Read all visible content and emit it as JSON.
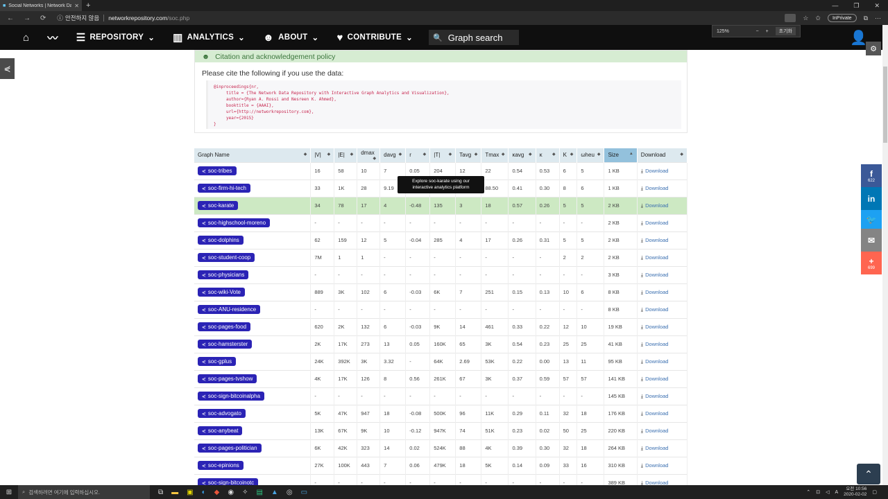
{
  "browser": {
    "tab_title": "Social Networks | Network Data",
    "new_tab": "+",
    "win_min": "—",
    "win_max": "❐",
    "win_close": "✕",
    "nav_back": "←",
    "nav_forward": "→",
    "nav_refresh": "⟳",
    "security_label": "안전하지 않음",
    "url_host": "networkrepository.com",
    "url_path": "/soc.php",
    "inprivate": "InPrivate",
    "zoom_level": "125%",
    "zoom_minus": "−",
    "zoom_plus": "+",
    "zoom_reset": "초기화"
  },
  "sitenav": {
    "items": [
      {
        "label": "",
        "icon": "⌂"
      },
      {
        "label": "",
        "icon": "〰"
      },
      {
        "label": "REPOSITORY",
        "icon": "☰"
      },
      {
        "label": "ANALYTICS",
        "icon": "▥"
      },
      {
        "label": "ABOUT",
        "icon": "☻"
      },
      {
        "label": "CONTRIBUTE",
        "icon": "♥"
      }
    ],
    "search_label": "Graph search",
    "search_icon": "🔍",
    "user_icon": "👤"
  },
  "citation": {
    "heading": "Citation and acknowledgement policy",
    "intro": "Please cite the following if you use the data:",
    "bibtex": "@inproceedings{nr,\n     title = {The Network Data Repository with Interactive Graph Analytics and Visualization},\n     author={Ryan A. Rossi and Nesreen K. Ahmed},\n     booktitle = {AAAI},\n     url={http://networkrepository.com},\n     year={2015}\n}"
  },
  "table": {
    "headers": [
      "Graph Name",
      "|V|",
      "|E|",
      "dmax",
      "davg",
      "r",
      "|T|",
      "Tavg",
      "Tmax",
      "κavg",
      "κ",
      "K",
      "ωheu",
      "Size",
      "Download"
    ],
    "rows": [
      [
        "soc-tribes",
        "16",
        "58",
        "10",
        "7",
        "0.05",
        "204",
        "12",
        "22",
        "0.54",
        "0.53",
        "6",
        "5",
        "1 KB"
      ],
      [
        "soc-firm-hi-tech",
        "33",
        "1K",
        "28",
        "9.19",
        "",
        "",
        "",
        "88.50",
        "0.41",
        "0.30",
        "8",
        "6",
        "1 KB"
      ],
      [
        "soc-karate",
        "34",
        "78",
        "17",
        "4",
        "-0.48",
        "135",
        "3",
        "18",
        "0.57",
        "0.26",
        "5",
        "5",
        "2 KB"
      ],
      [
        "soc-highschool-moreno",
        "-",
        "-",
        "-",
        "-",
        "-",
        "-",
        "-",
        "-",
        "-",
        "-",
        "-",
        "-",
        "2 KB"
      ],
      [
        "soc-dolphins",
        "62",
        "159",
        "12",
        "5",
        "-0.04",
        "285",
        "4",
        "17",
        "0.26",
        "0.31",
        "5",
        "5",
        "2 KB"
      ],
      [
        "soc-student-coop",
        "7M",
        "1",
        "1",
        "-",
        "-",
        "-",
        "-",
        "-",
        "-",
        "-",
        "2",
        "2",
        "2 KB"
      ],
      [
        "soc-physicians",
        "-",
        "-",
        "-",
        "-",
        "-",
        "-",
        "-",
        "-",
        "-",
        "-",
        "-",
        "-",
        "3 KB"
      ],
      [
        "soc-wiki-Vote",
        "889",
        "3K",
        "102",
        "6",
        "-0.03",
        "6K",
        "7",
        "251",
        "0.15",
        "0.13",
        "10",
        "6",
        "8 KB"
      ],
      [
        "soc-ANU-residence",
        "-",
        "-",
        "-",
        "-",
        "-",
        "-",
        "-",
        "-",
        "-",
        "-",
        "-",
        "-",
        "8 KB"
      ],
      [
        "soc-pages-food",
        "620",
        "2K",
        "132",
        "6",
        "-0.03",
        "9K",
        "14",
        "461",
        "0.33",
        "0.22",
        "12",
        "10",
        "19 KB"
      ],
      [
        "soc-hamsterster",
        "2K",
        "17K",
        "273",
        "13",
        "0.05",
        "160K",
        "65",
        "3K",
        "0.54",
        "0.23",
        "25",
        "25",
        "41 KB"
      ],
      [
        "soc-gplus",
        "24K",
        "392K",
        "3K",
        "3.32",
        "-",
        "64K",
        "2.69",
        "53K",
        "0.22",
        "0.00",
        "13",
        "11",
        "95 KB"
      ],
      [
        "soc-pages-tvshow",
        "4K",
        "17K",
        "126",
        "8",
        "0.56",
        "261K",
        "67",
        "3K",
        "0.37",
        "0.59",
        "57",
        "57",
        "141 KB"
      ],
      [
        "soc-sign-bitcoinalpha",
        "-",
        "-",
        "-",
        "-",
        "-",
        "-",
        "-",
        "-",
        "-",
        "-",
        "-",
        "-",
        "145 KB"
      ],
      [
        "soc-advogato",
        "5K",
        "47K",
        "947",
        "18",
        "-0.08",
        "500K",
        "96",
        "11K",
        "0.29",
        "0.11",
        "32",
        "18",
        "176 KB"
      ],
      [
        "soc-anybeat",
        "13K",
        "67K",
        "9K",
        "10",
        "-0.12",
        "947K",
        "74",
        "51K",
        "0.23",
        "0.02",
        "50",
        "25",
        "220 KB"
      ],
      [
        "soc-pages-politician",
        "6K",
        "42K",
        "323",
        "14",
        "0.02",
        "524K",
        "88",
        "4K",
        "0.39",
        "0.30",
        "32",
        "18",
        "264 KB"
      ],
      [
        "soc-epinions",
        "27K",
        "100K",
        "443",
        "7",
        "0.06",
        "479K",
        "18",
        "5K",
        "0.14",
        "0.09",
        "33",
        "16",
        "310 KB"
      ],
      [
        "soc-sign-bitcoinotc",
        "-",
        "-",
        "-",
        "-",
        "-",
        "-",
        "-",
        "-",
        "-",
        "-",
        "-",
        "-",
        "389 KB"
      ]
    ],
    "download_label": "Download",
    "highlight_row": 2
  },
  "tooltip": {
    "line1": "Explore soc-karate using our",
    "line2": "interactive analytics platform"
  },
  "social": [
    {
      "icon": "f",
      "count": "622",
      "color": "#3b5998"
    },
    {
      "icon": "in",
      "count": "",
      "color": "#0077b5"
    },
    {
      "icon": "🐦",
      "count": "",
      "color": "#1da1f2"
    },
    {
      "icon": "✉",
      "count": "",
      "color": "#848484"
    },
    {
      "icon": "+",
      "count": "699",
      "color": "#ff6550"
    }
  ],
  "taskbar": {
    "search_placeholder": "검색하려면 여기에 입력하십시오.",
    "time": "오전 10:56",
    "date": "2020-02-02"
  }
}
